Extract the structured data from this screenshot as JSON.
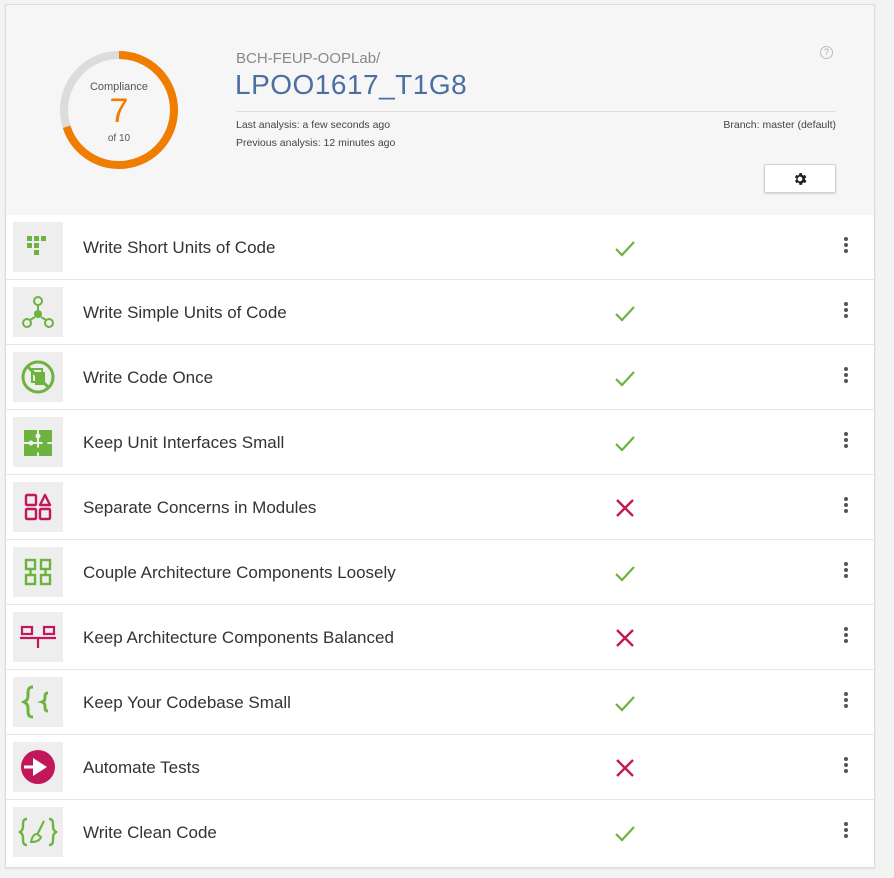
{
  "colors": {
    "pass": "#6cb33f",
    "fail": "#c2185b",
    "gauge": "#f07c00",
    "title": "#4a6fa0"
  },
  "header": {
    "gauge": {
      "label": "Compliance",
      "score": "7",
      "of": "of 10",
      "compliance_fraction": 0.7
    },
    "org": "BCH-FEUP-OOPLab/",
    "project": "LPOO1617_T1G8",
    "last_analysis": "Last analysis: a few seconds ago",
    "previous_analysis": "Previous analysis: 12 minutes ago",
    "branch": "Branch: master (default)",
    "help_icon": "help-circle-icon",
    "settings_icon": "gear-icon"
  },
  "guidelines": [
    {
      "label": "Write Short Units of Code",
      "status": "pass",
      "icon": "short-units-icon"
    },
    {
      "label": "Write Simple Units of Code",
      "status": "pass",
      "icon": "simple-units-icon"
    },
    {
      "label": "Write Code Once",
      "status": "pass",
      "icon": "code-once-icon"
    },
    {
      "label": "Keep Unit Interfaces Small",
      "status": "pass",
      "icon": "puzzle-icon"
    },
    {
      "label": "Separate Concerns in Modules",
      "status": "fail",
      "icon": "modules-icon"
    },
    {
      "label": "Couple Architecture Components Loosely",
      "status": "pass",
      "icon": "components-icon"
    },
    {
      "label": "Keep Architecture Components Balanced",
      "status": "fail",
      "icon": "balanced-icon"
    },
    {
      "label": "Keep Your Codebase Small",
      "status": "pass",
      "icon": "braces-icon"
    },
    {
      "label": "Automate Tests",
      "status": "fail",
      "icon": "play-icon"
    },
    {
      "label": "Write Clean Code",
      "status": "pass",
      "icon": "clean-code-icon"
    }
  ]
}
